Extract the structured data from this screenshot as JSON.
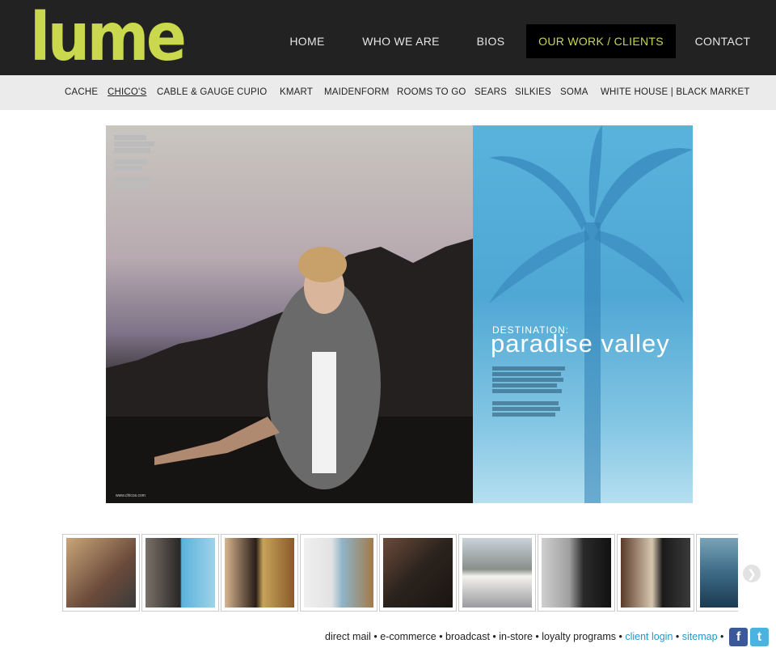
{
  "brand": {
    "logo": "lume",
    "accent": "#c9d84c",
    "header_bg": "#222222"
  },
  "nav": {
    "items": [
      {
        "label": "HOME"
      },
      {
        "label": "WHO WE ARE"
      },
      {
        "label": "BIOS"
      },
      {
        "label": "OUR WORK / CLIENTS",
        "active": true
      },
      {
        "label": "CONTACT"
      }
    ]
  },
  "subnav": {
    "items": [
      {
        "label": "CACHE"
      },
      {
        "label": "CHICO'S",
        "current": true
      },
      {
        "label": "CABLE & GAUGE"
      },
      {
        "label": "CUPIO"
      },
      {
        "label": "KMART"
      },
      {
        "label": "MAIDENFORM"
      },
      {
        "label": "ROOMS TO GO"
      },
      {
        "label": "SEARS"
      },
      {
        "label": "SILKIES"
      },
      {
        "label": "SOMA"
      },
      {
        "label": "WHITE HOUSE | BLACK MARKET"
      }
    ]
  },
  "hero": {
    "kicker": "DESTINATION:",
    "title": "paradise valley",
    "footer_url": "www.chicos.com"
  },
  "thumbnails": {
    "count_visible": 9,
    "next_icon": "chevron-right-icon"
  },
  "footer": {
    "services": "direct mail • e-commerce • broadcast • in-store • loyalty programs •",
    "client_login": "client login",
    "separator": "•",
    "sitemap": "sitemap",
    "trail": "•",
    "facebook_icon": "facebook-icon",
    "twitter_icon": "twitter-icon"
  }
}
